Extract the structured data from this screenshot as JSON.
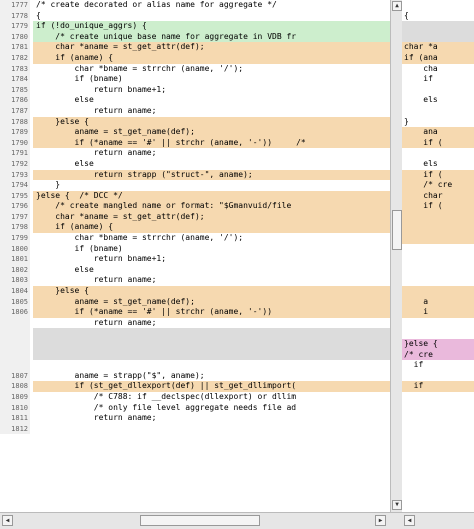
{
  "left_pane": {
    "lines": [
      {
        "num": "1777",
        "text": "/* create decorated or alias name for aggregate */ ",
        "hl": ""
      },
      {
        "num": "1778",
        "text": "{",
        "hl": ""
      },
      {
        "num": "1779",
        "text": "if (!do_unique_aggrs) {",
        "hl": "g"
      },
      {
        "num": "1780",
        "text": "    /* create unique base name for aggregate in VDB fr",
        "hl": "g"
      },
      {
        "num": "1781",
        "text": "    char *aname = st_get_attr(def);",
        "hl": "o"
      },
      {
        "num": "1782",
        "text": "    if (aname) {",
        "hl": "o"
      },
      {
        "num": "1783",
        "text": "        char *bname = strrchr (aname, '/');",
        "hl": ""
      },
      {
        "num": "1784",
        "text": "        if (bname)",
        "hl": ""
      },
      {
        "num": "1785",
        "text": "            return bname+1;",
        "hl": ""
      },
      {
        "num": "1786",
        "text": "        else",
        "hl": ""
      },
      {
        "num": "1787",
        "text": "            return aname;",
        "hl": ""
      },
      {
        "num": "1788",
        "text": "    }else {",
        "hl": "o"
      },
      {
        "num": "1789",
        "text": "        aname = st_get_name(def);",
        "hl": "o"
      },
      {
        "num": "1790",
        "text": "        if (*aname == '#' || strchr (aname, '-'))     /*",
        "hl": "o"
      },
      {
        "num": "1791",
        "text": "            return aname;",
        "hl": ""
      },
      {
        "num": "1792",
        "text": "        else",
        "hl": ""
      },
      {
        "num": "1793",
        "text": "            return strapp (\"struct-\", aname);",
        "hl": "o"
      },
      {
        "num": "1794",
        "text": "    }",
        "hl": ""
      },
      {
        "num": "1795",
        "text": "}else {  /* DCC */",
        "hl": "o"
      },
      {
        "num": "1796",
        "text": "    /* create mangled name or format: \"$Gmanvuid/file",
        "hl": "o"
      },
      {
        "num": "1797",
        "text": "    char *aname = st_get_attr(def);",
        "hl": "o"
      },
      {
        "num": "1798",
        "text": "    if (aname) {",
        "hl": "o"
      },
      {
        "num": "1799",
        "text": "        char *bname = strrchr (aname, '/');",
        "hl": ""
      },
      {
        "num": "1800",
        "text": "        if (bname)",
        "hl": ""
      },
      {
        "num": "1801",
        "text": "            return bname+1;",
        "hl": ""
      },
      {
        "num": "1802",
        "text": "        else",
        "hl": ""
      },
      {
        "num": "1803",
        "text": "            return aname;",
        "hl": ""
      },
      {
        "num": "1804",
        "text": "    }else {",
        "hl": "o"
      },
      {
        "num": "1805",
        "text": "        aname = st_get_name(def);",
        "hl": "o"
      },
      {
        "num": "1806",
        "text": "        if (*aname == '#' || strchr (aname, '-'))",
        "hl": "o"
      },
      {
        "num": "",
        "text": "            return aname;",
        "hl": ""
      },
      {
        "num": "",
        "text": "",
        "hl": "d"
      },
      {
        "num": "",
        "text": "",
        "hl": "d"
      },
      {
        "num": "",
        "text": "",
        "hl": "d"
      },
      {
        "num": "",
        "text": "",
        "hl": ""
      },
      {
        "num": "1807",
        "text": "        aname = strapp(\"$\", aname);",
        "hl": ""
      },
      {
        "num": "1808",
        "text": "        if (st_get_dllexport(def) || st_get_dllimport(",
        "hl": "o"
      },
      {
        "num": "1809",
        "text": "            /* C788: if __declspec(dllexport) or dllim",
        "hl": ""
      },
      {
        "num": "1810",
        "text": "            /* only file level aggregate needs file ad",
        "hl": ""
      },
      {
        "num": "1811",
        "text": "            return aname;",
        "hl": ""
      },
      {
        "num": "1812",
        "text": "",
        "hl": ""
      }
    ]
  },
  "right_pane": {
    "lines": [
      {
        "text": "",
        "hl": ""
      },
      {
        "text": "{",
        "hl": ""
      },
      {
        "text": "",
        "hl": "d"
      },
      {
        "text": "",
        "hl": "d"
      },
      {
        "text": "char *a",
        "hl": "o"
      },
      {
        "text": "if (ana",
        "hl": "o"
      },
      {
        "text": "    cha",
        "hl": ""
      },
      {
        "text": "    if",
        "hl": ""
      },
      {
        "text": "",
        "hl": ""
      },
      {
        "text": "    els",
        "hl": ""
      },
      {
        "text": "",
        "hl": ""
      },
      {
        "text": "}",
        "hl": ""
      },
      {
        "text": "    ana",
        "hl": "o"
      },
      {
        "text": "    if (",
        "hl": "o"
      },
      {
        "text": "",
        "hl": ""
      },
      {
        "text": "    els",
        "hl": ""
      },
      {
        "text": "    if (",
        "hl": "o"
      },
      {
        "text": "    /* cre",
        "hl": "o"
      },
      {
        "text": "    char",
        "hl": "o"
      },
      {
        "text": "    if (",
        "hl": "o"
      },
      {
        "text": "",
        "hl": "o"
      },
      {
        "text": "",
        "hl": "o"
      },
      {
        "text": "",
        "hl": "o"
      },
      {
        "text": "",
        "hl": ""
      },
      {
        "text": "",
        "hl": ""
      },
      {
        "text": "",
        "hl": ""
      },
      {
        "text": "",
        "hl": ""
      },
      {
        "text": "",
        "hl": "o"
      },
      {
        "text": "    a",
        "hl": "o"
      },
      {
        "text": "    i",
        "hl": "o"
      },
      {
        "text": "",
        "hl": ""
      },
      {
        "text": "",
        "hl": ""
      },
      {
        "text": "}else {",
        "hl": "p"
      },
      {
        "text": "/* cre",
        "hl": "p"
      },
      {
        "text": "  if",
        "hl": ""
      },
      {
        "text": "",
        "hl": ""
      },
      {
        "text": "  if",
        "hl": "o"
      },
      {
        "text": "",
        "hl": ""
      },
      {
        "text": "",
        "hl": ""
      },
      {
        "text": "",
        "hl": ""
      },
      {
        "text": "",
        "hl": ""
      }
    ]
  },
  "scrollbars": {
    "up_arrow": "▲",
    "down_arrow": "▼",
    "left_arrow": "◀",
    "right_arrow": "▶"
  }
}
